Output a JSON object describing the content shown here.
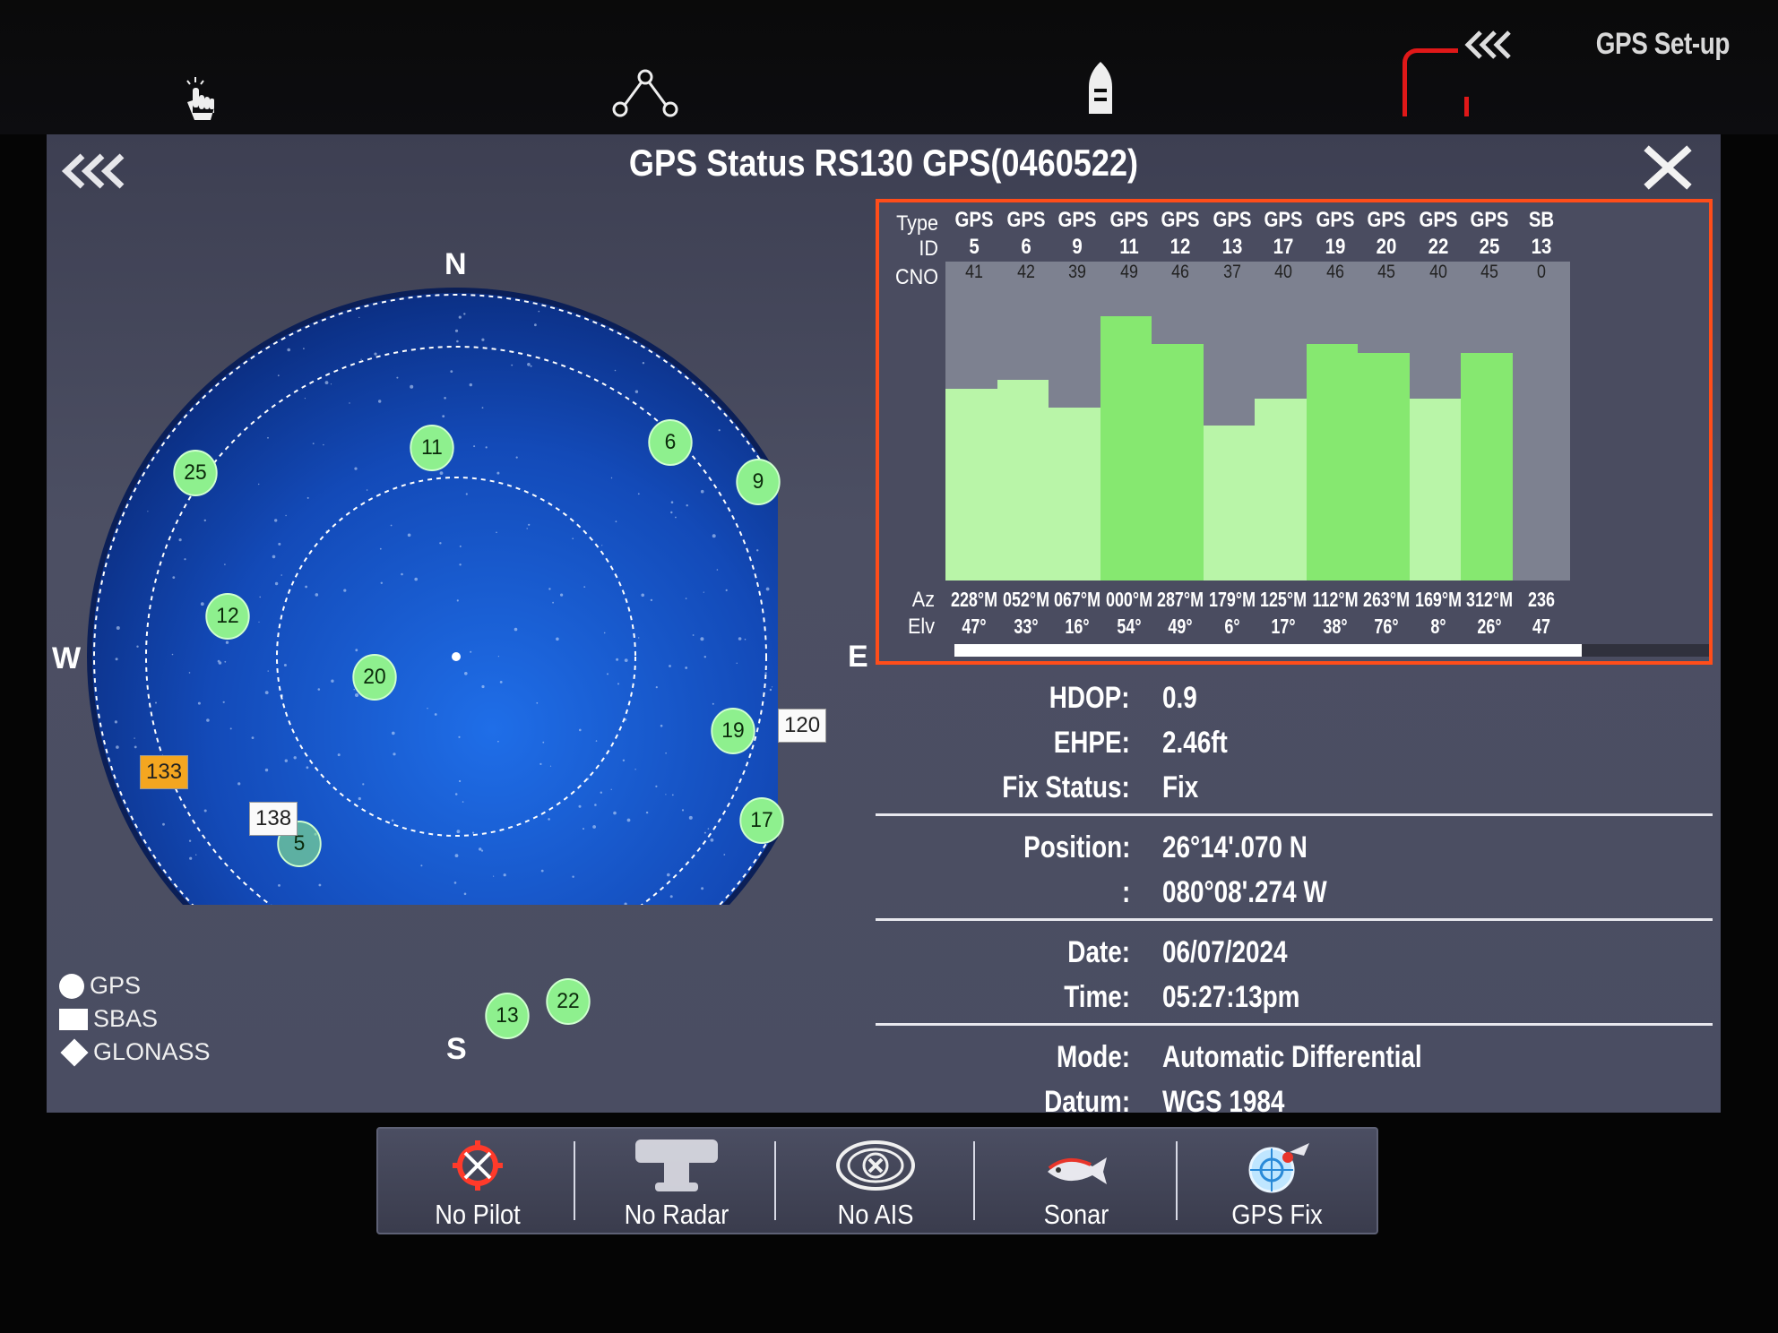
{
  "header": {
    "setup_label": "GPS Set-up",
    "icons": [
      "touch-icon",
      "route-icon",
      "boat-icon"
    ],
    "accent_color": "#e01818"
  },
  "panel": {
    "title": "GPS Status RS130 GPS(0460522)"
  },
  "skyplot": {
    "compass": {
      "n": "N",
      "e": "E",
      "s": "S",
      "w": "W"
    },
    "gps_sats": [
      "25",
      "11",
      "6",
      "9",
      "12",
      "20",
      "19",
      "17",
      "5",
      "13",
      "22"
    ],
    "sbas_sats": [
      "133",
      "138",
      "120"
    ],
    "legend": {
      "gps": "GPS",
      "sbas": "SBAS",
      "glonass": "GLONASS"
    }
  },
  "signal": {
    "row_labels": {
      "type": "Type",
      "id": "ID",
      "cno": "CNO",
      "az": "Az",
      "elv": "Elv"
    },
    "columns": [
      {
        "type": "GPS",
        "id": "5",
        "cno": 41,
        "az": "228°M",
        "elv": "47°"
      },
      {
        "type": "GPS",
        "id": "6",
        "cno": 42,
        "az": "052°M",
        "elv": "33°"
      },
      {
        "type": "GPS",
        "id": "9",
        "cno": 39,
        "az": "067°M",
        "elv": "16°"
      },
      {
        "type": "GPS",
        "id": "11",
        "cno": 49,
        "az": "000°M",
        "elv": "54°"
      },
      {
        "type": "GPS",
        "id": "12",
        "cno": 46,
        "az": "287°M",
        "elv": "49°"
      },
      {
        "type": "GPS",
        "id": "13",
        "cno": 37,
        "az": "179°M",
        "elv": "6°"
      },
      {
        "type": "GPS",
        "id": "17",
        "cno": 40,
        "az": "125°M",
        "elv": "17°"
      },
      {
        "type": "GPS",
        "id": "19",
        "cno": 46,
        "az": "112°M",
        "elv": "38°"
      },
      {
        "type": "GPS",
        "id": "20",
        "cno": 45,
        "az": "263°M",
        "elv": "76°"
      },
      {
        "type": "GPS",
        "id": "22",
        "cno": 40,
        "az": "169°M",
        "elv": "8°"
      },
      {
        "type": "GPS",
        "id": "25",
        "cno": 45,
        "az": "312°M",
        "elv": "26°"
      },
      {
        "type": "SB",
        "id": "13",
        "cno": 0,
        "az": "236",
        "elv": "47"
      }
    ]
  },
  "info": {
    "hdop_label": "HDOP:",
    "hdop": "0.9",
    "ehpe_label": "EHPE:",
    "ehpe": "2.46ft",
    "fix_label": "Fix Status:",
    "fix": "Fix",
    "position_label": "Position:",
    "lat": "26°14'.070 N",
    "lon_label": ":",
    "lon": "080°08'.274 W",
    "date_label": "Date:",
    "date": "06/07/2024",
    "time_label": "Time:",
    "time": "05:27:13pm",
    "mode_label": "Mode:",
    "mode": "Automatic Differential",
    "datum_label": "Datum:",
    "datum": "WGS 1984"
  },
  "dock": [
    {
      "label": "No Pilot",
      "icon": "autopilot-off-icon"
    },
    {
      "label": "No Radar",
      "icon": "radar-icon"
    },
    {
      "label": "No AIS",
      "icon": "ais-off-icon"
    },
    {
      "label": "Sonar",
      "icon": "fish-icon"
    },
    {
      "label": "GPS Fix",
      "icon": "gps-fix-icon"
    }
  ]
}
